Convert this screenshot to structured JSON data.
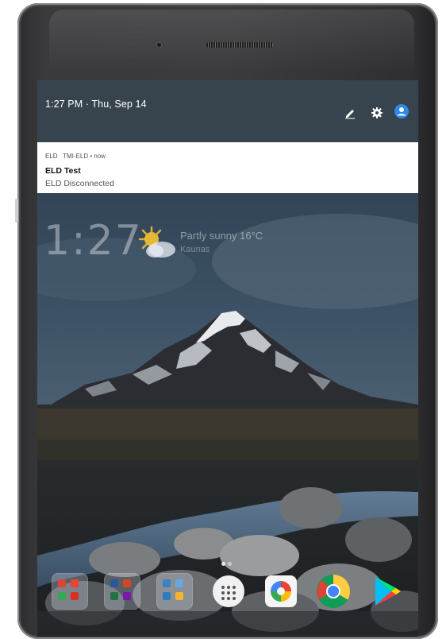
{
  "status": {
    "time_date": "1:27 PM · Thu, Sep 14",
    "icons": [
      "edit-icon",
      "settings-gear-icon",
      "user-account-icon"
    ]
  },
  "notification": {
    "app_badge": "ELD",
    "app_name": "TMI-ELD",
    "separator": "•",
    "time": "now",
    "title": "ELD Test",
    "text": "ELD Disconnected"
  },
  "homescreen": {
    "clock": "1:27",
    "weather": "Partly sunny  16°C",
    "city": "Kaunas"
  },
  "dock": {
    "apps": [
      "google-apps-folder",
      "office-apps-folder",
      "tools-apps-folder",
      "app-drawer",
      "photos-app",
      "chrome-app",
      "play-store-app"
    ]
  },
  "colors": {
    "header_bg": "#38444d",
    "notification_bg": "#ffffff",
    "accent_user": "#2f88e8"
  }
}
